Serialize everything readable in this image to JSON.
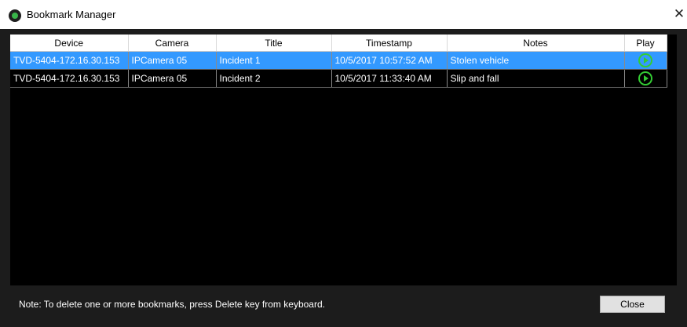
{
  "window": {
    "title": "Bookmark Manager",
    "close_glyph": "✕"
  },
  "grid": {
    "columns": [
      "Device",
      "Camera",
      "Title",
      "Timestamp",
      "Notes",
      "Play"
    ],
    "rows": [
      {
        "device": "TVD-5404-172.16.30.153",
        "camera": "IPCamera 05",
        "title": "Incident 1",
        "timestamp": "10/5/2017 10:57:52 AM",
        "notes": "Stolen vehicle",
        "play_icon": "play-circle-icon",
        "selected": true
      },
      {
        "device": "TVD-5404-172.16.30.153",
        "camera": "IPCamera 05",
        "title": "Incident 2",
        "timestamp": "10/5/2017 11:33:40 AM",
        "notes": "Slip and fall",
        "play_icon": "play-circle-icon",
        "selected": false
      }
    ]
  },
  "footer": {
    "note": "Note: To delete one or more bookmarks, press Delete key from keyboard.",
    "close_label": "Close"
  },
  "colors": {
    "selection": "#3399ff",
    "play_icon": "#33cc33",
    "grid_background": "#000000",
    "window_background": "#1c1c1c"
  }
}
